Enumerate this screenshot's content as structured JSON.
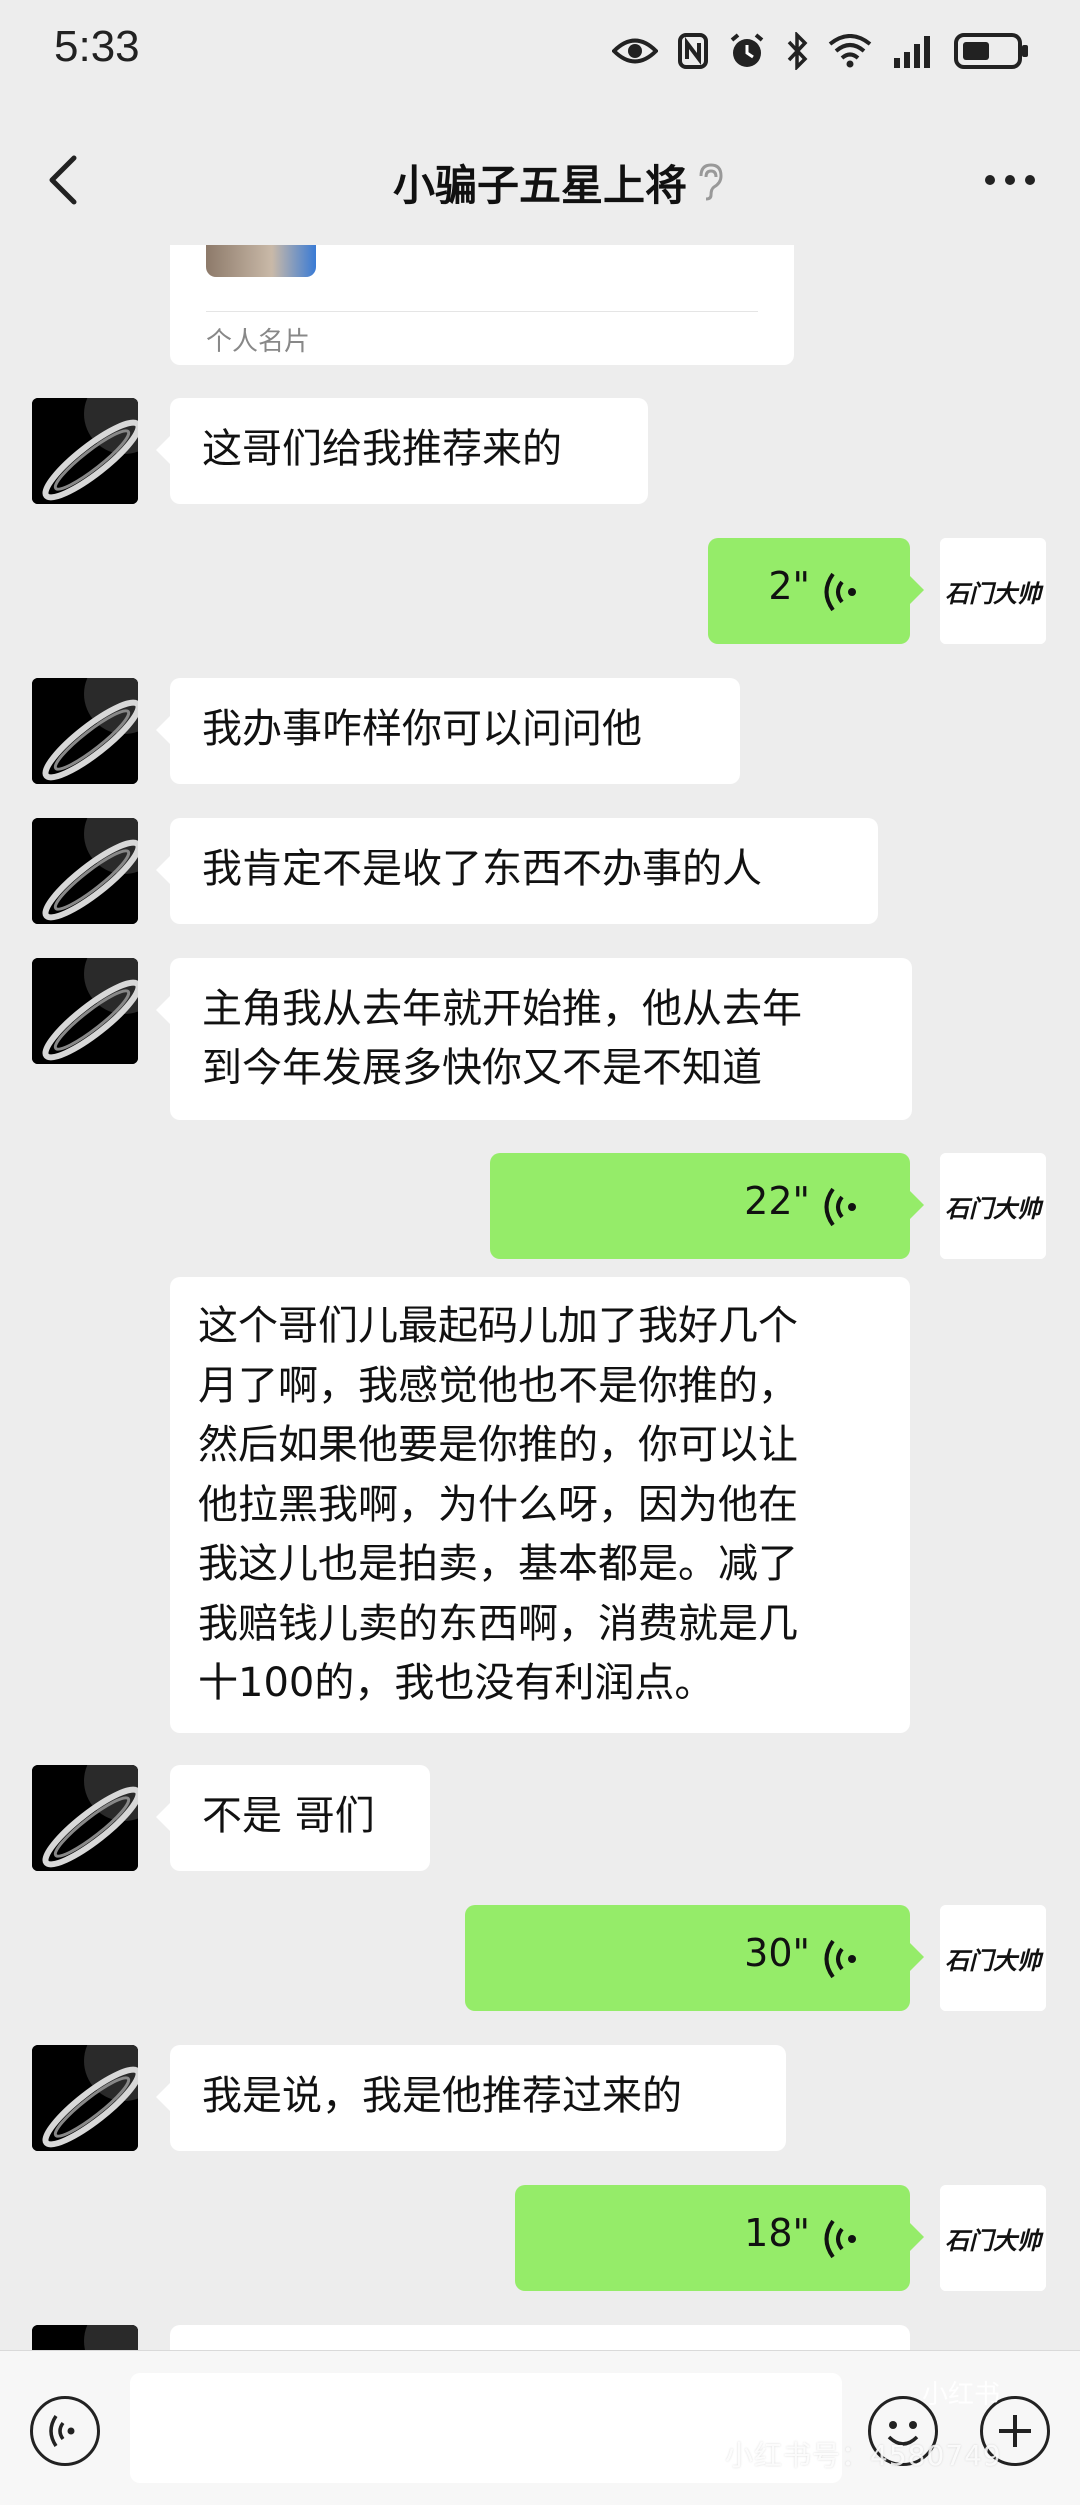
{
  "status_bar": {
    "time": "5:33",
    "icons": [
      "eye-icon",
      "nfc-icon",
      "alarm-icon",
      "bluetooth-icon",
      "wifi-icon",
      "signal-icon",
      "battery-icon"
    ]
  },
  "nav": {
    "title": "小骗子五星上将",
    "icons": [
      "back-icon",
      "ear-icon",
      "more-icon"
    ]
  },
  "card": {
    "label": "个人名片"
  },
  "messages": [
    {
      "side": "left",
      "text": "这哥们给我推荐来的"
    },
    {
      "side": "right",
      "type": "voice",
      "duration": "2\""
    },
    {
      "side": "left",
      "text": "我办事咋样你可以问问他"
    },
    {
      "side": "left",
      "text": "我肯定不是收了东西不办事的人"
    },
    {
      "side": "left",
      "text_lines": [
        "主角我从去年就开始推，他从去年",
        "到今年发展多快你又不是不知道"
      ]
    },
    {
      "side": "right",
      "type": "voice",
      "duration": "22\""
    },
    {
      "side": "left",
      "text_lines": [
        "这个哥们儿最起码儿加了我好几个",
        "月了啊，我感觉他也不是你推的，",
        "然后如果他要是你推的，你可以让",
        "他拉黑我啊，为什么呀，因为他在",
        "我这儿也是拍卖，基本都是。减了",
        "我赔钱儿卖的东西啊，消费就是几",
        "十100的，我也没有利润点。"
      ]
    },
    {
      "side": "left",
      "text": "不是 哥们"
    },
    {
      "side": "right",
      "type": "voice",
      "duration": "30\""
    },
    {
      "side": "left",
      "text": "我是说，我是他推荐过来的"
    },
    {
      "side": "right",
      "type": "voice",
      "duration": "18\""
    }
  ],
  "right_avatar_text": "石门大帅",
  "bottom_bar": {
    "icons": [
      "voice-icon",
      "emoji-icon",
      "plus-icon"
    ],
    "input_placeholder": ""
  },
  "watermark": {
    "text": "小红书号：4580749",
    "logo": "小红书"
  },
  "colors": {
    "background": "#EDEDED",
    "bubble_sent": "#95EC69",
    "bubble_received": "#FFFFFF"
  }
}
